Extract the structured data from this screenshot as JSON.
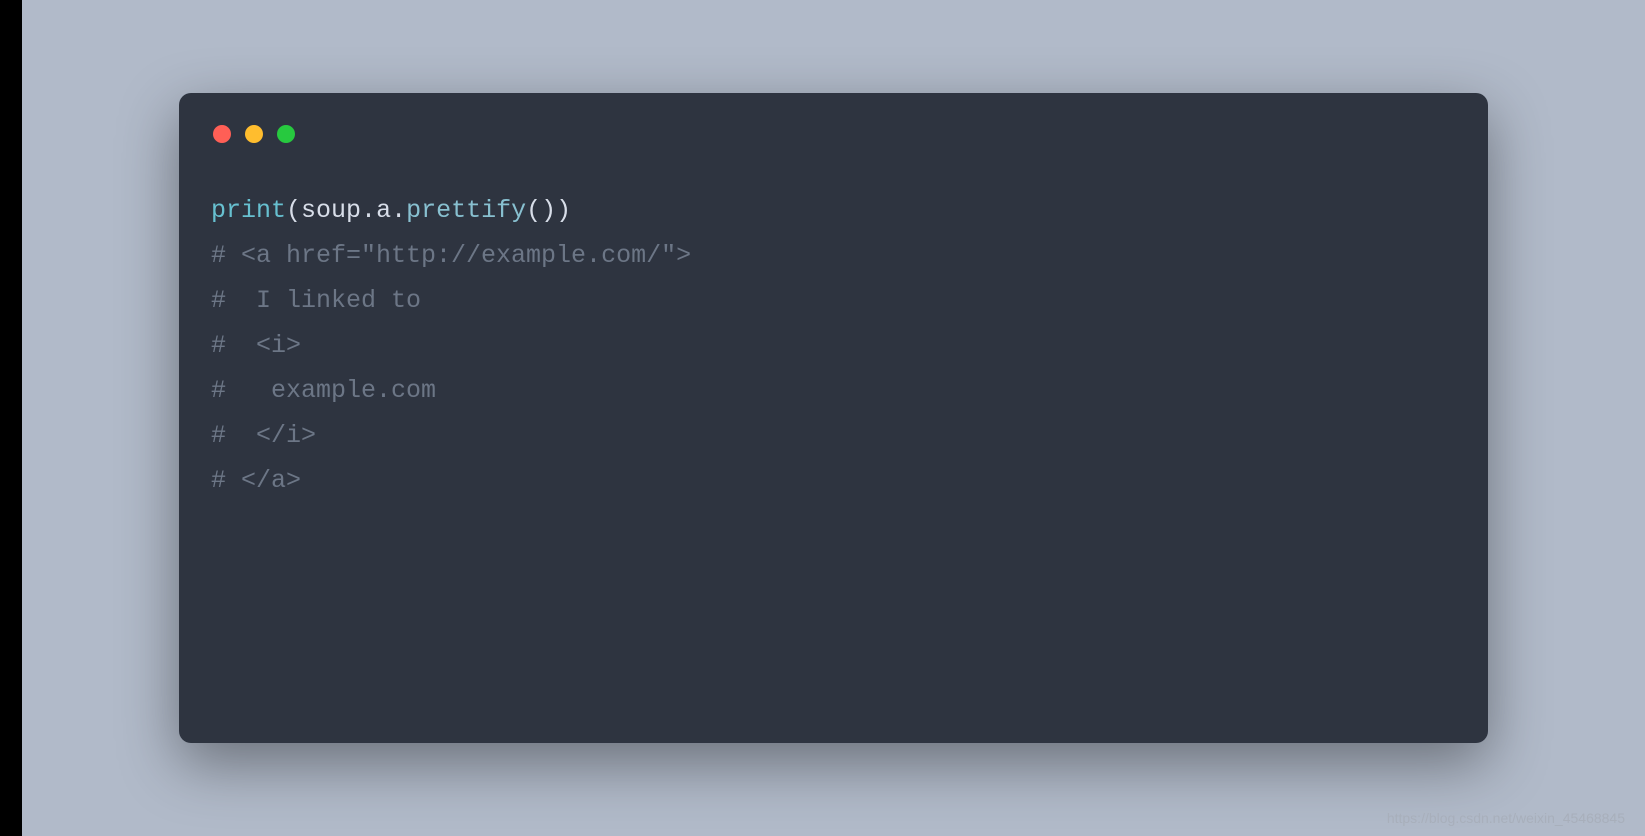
{
  "colors": {
    "red": "#ff5f56",
    "yellow": "#ffbd2e",
    "green": "#27c93f",
    "window_bg": "#2e3440",
    "page_bg": "#b1bac9"
  },
  "code": {
    "line1": {
      "func": "print",
      "lparen": "(",
      "obj": "soup",
      "dot1": ".",
      "attr": "a",
      "dot2": ".",
      "method": "prettify",
      "parens": "()",
      "rparen": ")"
    },
    "line2": "# <a href=\"http://example.com/\">",
    "line3": "#  I linked to",
    "line4": "#  <i>",
    "line5": "#   example.com",
    "line6": "#  </i>",
    "line7": "# </a>"
  },
  "watermark": "https://blog.csdn.net/weixin_45468845"
}
